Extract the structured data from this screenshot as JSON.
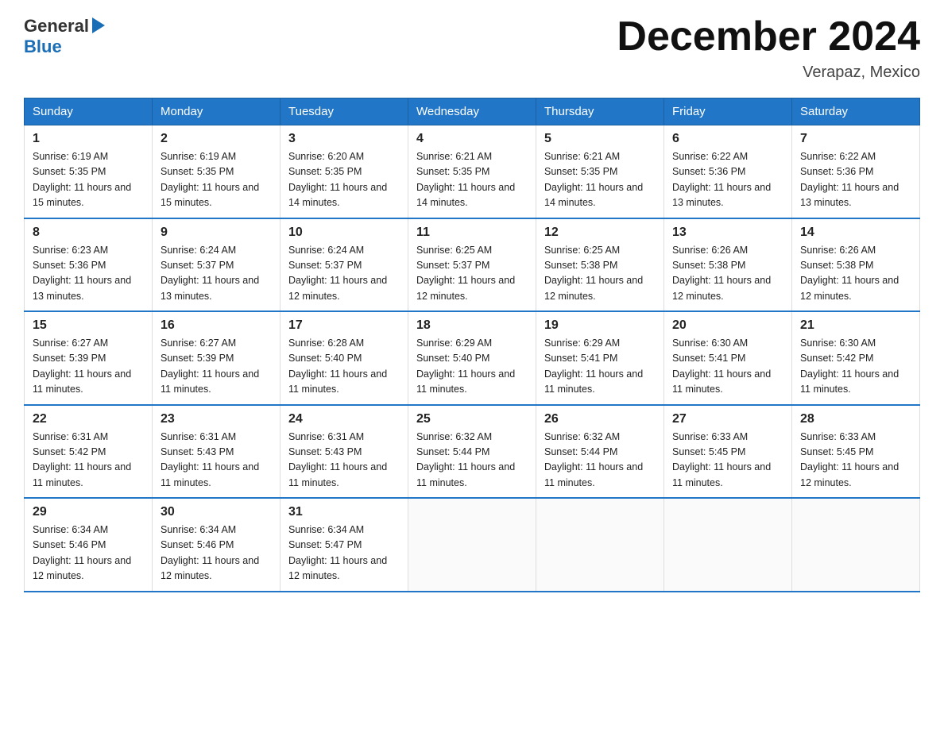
{
  "header": {
    "logo_text_general": "General",
    "logo_text_blue": "Blue",
    "month_title": "December 2024",
    "subtitle": "Verapaz, Mexico"
  },
  "weekdays": [
    "Sunday",
    "Monday",
    "Tuesday",
    "Wednesday",
    "Thursday",
    "Friday",
    "Saturday"
  ],
  "weeks": [
    [
      {
        "day": "1",
        "sunrise": "6:19 AM",
        "sunset": "5:35 PM",
        "daylight": "11 hours and 15 minutes."
      },
      {
        "day": "2",
        "sunrise": "6:19 AM",
        "sunset": "5:35 PM",
        "daylight": "11 hours and 15 minutes."
      },
      {
        "day": "3",
        "sunrise": "6:20 AM",
        "sunset": "5:35 PM",
        "daylight": "11 hours and 14 minutes."
      },
      {
        "day": "4",
        "sunrise": "6:21 AM",
        "sunset": "5:35 PM",
        "daylight": "11 hours and 14 minutes."
      },
      {
        "day": "5",
        "sunrise": "6:21 AM",
        "sunset": "5:35 PM",
        "daylight": "11 hours and 14 minutes."
      },
      {
        "day": "6",
        "sunrise": "6:22 AM",
        "sunset": "5:36 PM",
        "daylight": "11 hours and 13 minutes."
      },
      {
        "day": "7",
        "sunrise": "6:22 AM",
        "sunset": "5:36 PM",
        "daylight": "11 hours and 13 minutes."
      }
    ],
    [
      {
        "day": "8",
        "sunrise": "6:23 AM",
        "sunset": "5:36 PM",
        "daylight": "11 hours and 13 minutes."
      },
      {
        "day": "9",
        "sunrise": "6:24 AM",
        "sunset": "5:37 PM",
        "daylight": "11 hours and 13 minutes."
      },
      {
        "day": "10",
        "sunrise": "6:24 AM",
        "sunset": "5:37 PM",
        "daylight": "11 hours and 12 minutes."
      },
      {
        "day": "11",
        "sunrise": "6:25 AM",
        "sunset": "5:37 PM",
        "daylight": "11 hours and 12 minutes."
      },
      {
        "day": "12",
        "sunrise": "6:25 AM",
        "sunset": "5:38 PM",
        "daylight": "11 hours and 12 minutes."
      },
      {
        "day": "13",
        "sunrise": "6:26 AM",
        "sunset": "5:38 PM",
        "daylight": "11 hours and 12 minutes."
      },
      {
        "day": "14",
        "sunrise": "6:26 AM",
        "sunset": "5:38 PM",
        "daylight": "11 hours and 12 minutes."
      }
    ],
    [
      {
        "day": "15",
        "sunrise": "6:27 AM",
        "sunset": "5:39 PM",
        "daylight": "11 hours and 11 minutes."
      },
      {
        "day": "16",
        "sunrise": "6:27 AM",
        "sunset": "5:39 PM",
        "daylight": "11 hours and 11 minutes."
      },
      {
        "day": "17",
        "sunrise": "6:28 AM",
        "sunset": "5:40 PM",
        "daylight": "11 hours and 11 minutes."
      },
      {
        "day": "18",
        "sunrise": "6:29 AM",
        "sunset": "5:40 PM",
        "daylight": "11 hours and 11 minutes."
      },
      {
        "day": "19",
        "sunrise": "6:29 AM",
        "sunset": "5:41 PM",
        "daylight": "11 hours and 11 minutes."
      },
      {
        "day": "20",
        "sunrise": "6:30 AM",
        "sunset": "5:41 PM",
        "daylight": "11 hours and 11 minutes."
      },
      {
        "day": "21",
        "sunrise": "6:30 AM",
        "sunset": "5:42 PM",
        "daylight": "11 hours and 11 minutes."
      }
    ],
    [
      {
        "day": "22",
        "sunrise": "6:31 AM",
        "sunset": "5:42 PM",
        "daylight": "11 hours and 11 minutes."
      },
      {
        "day": "23",
        "sunrise": "6:31 AM",
        "sunset": "5:43 PM",
        "daylight": "11 hours and 11 minutes."
      },
      {
        "day": "24",
        "sunrise": "6:31 AM",
        "sunset": "5:43 PM",
        "daylight": "11 hours and 11 minutes."
      },
      {
        "day": "25",
        "sunrise": "6:32 AM",
        "sunset": "5:44 PM",
        "daylight": "11 hours and 11 minutes."
      },
      {
        "day": "26",
        "sunrise": "6:32 AM",
        "sunset": "5:44 PM",
        "daylight": "11 hours and 11 minutes."
      },
      {
        "day": "27",
        "sunrise": "6:33 AM",
        "sunset": "5:45 PM",
        "daylight": "11 hours and 11 minutes."
      },
      {
        "day": "28",
        "sunrise": "6:33 AM",
        "sunset": "5:45 PM",
        "daylight": "11 hours and 12 minutes."
      }
    ],
    [
      {
        "day": "29",
        "sunrise": "6:34 AM",
        "sunset": "5:46 PM",
        "daylight": "11 hours and 12 minutes."
      },
      {
        "day": "30",
        "sunrise": "6:34 AM",
        "sunset": "5:46 PM",
        "daylight": "11 hours and 12 minutes."
      },
      {
        "day": "31",
        "sunrise": "6:34 AM",
        "sunset": "5:47 PM",
        "daylight": "11 hours and 12 minutes."
      },
      null,
      null,
      null,
      null
    ]
  ]
}
